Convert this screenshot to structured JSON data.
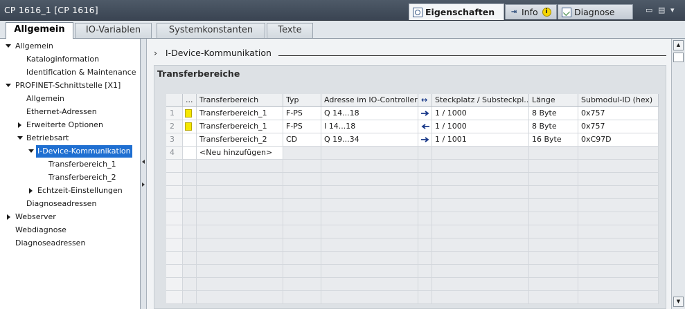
{
  "window": {
    "title": "CP 1616_1 [CP 1616]"
  },
  "inspector_tabs": [
    {
      "label": "Eigenschaften",
      "icon": "properties-icon",
      "active": true
    },
    {
      "label": "Info",
      "icon": "info-icon",
      "badge": "i",
      "active": false
    },
    {
      "label": "Diagnose",
      "icon": "diagnose-icon",
      "active": false
    }
  ],
  "window_controls": {
    "restore": "▭",
    "menu": "▤",
    "dropdown": "▾"
  },
  "subtabs": [
    {
      "label": "Allgemein",
      "active": true
    },
    {
      "label": "IO-Variablen",
      "active": false
    },
    {
      "label": "Systemkonstanten",
      "active": false
    },
    {
      "label": "Texte",
      "active": false
    }
  ],
  "nav": {
    "items": [
      {
        "label": "Allgemein",
        "level": 0,
        "expander": "down"
      },
      {
        "label": "Kataloginformation",
        "level": 1,
        "expander": "none"
      },
      {
        "label": "Identification & Maintenance",
        "level": 1,
        "expander": "none"
      },
      {
        "label": "PROFINET-Schnittstelle [X1]",
        "level": 0,
        "expander": "down"
      },
      {
        "label": "Allgemein",
        "level": 1,
        "expander": "none"
      },
      {
        "label": "Ethernet-Adressen",
        "level": 1,
        "expander": "none"
      },
      {
        "label": "Erweiterte Optionen",
        "level": 1,
        "expander": "right"
      },
      {
        "label": "Betriebsart",
        "level": 1,
        "expander": "down"
      },
      {
        "label": "I-Device-Kommunikation",
        "level": 2,
        "expander": "down",
        "selected": true
      },
      {
        "label": "Transferbereich_1",
        "level": 3,
        "expander": "none"
      },
      {
        "label": "Transferbereich_2",
        "level": 3,
        "expander": "none"
      },
      {
        "label": "Echtzeit-Einstellungen",
        "level": 2,
        "expander": "right"
      },
      {
        "label": "Diagnoseadressen",
        "level": 1,
        "expander": "none"
      },
      {
        "label": "Webserver",
        "level": 0,
        "expander": "right"
      },
      {
        "label": "Webdiagnose",
        "level": 0,
        "expander": "none"
      },
      {
        "label": "Diagnoseadressen",
        "level": 0,
        "expander": "none"
      }
    ]
  },
  "content": {
    "section_header": "I-Device-Kommunikation",
    "section_chevron": "›",
    "panel_title": "Transferbereiche"
  },
  "table": {
    "columns": [
      "",
      "...",
      "Transferbereich",
      "Typ",
      "Adresse im IO-Controller",
      "↔",
      "Steckplatz / Substeckpl...",
      "Länge",
      "Submodul-ID (hex)"
    ],
    "rows": [
      {
        "num": "1",
        "marker": "yellow",
        "name": "Transferbereich_1",
        "type": "F-PS",
        "address": "Q 14...18",
        "direction": "right",
        "slot": "1 / 1000",
        "length": "8 Byte",
        "submodule": "0x757"
      },
      {
        "num": "2",
        "marker": "yellow",
        "name": "Transferbereich_1",
        "type": "F-PS",
        "address": "I 14...18",
        "direction": "left",
        "slot": "1 / 1000",
        "length": "8 Byte",
        "submodule": "0x757"
      },
      {
        "num": "3",
        "marker": "none",
        "name": "Transferbereich_2",
        "type": "CD",
        "address": "Q 19...34",
        "direction": "right",
        "slot": "1 / 1001",
        "length": "16 Byte",
        "submodule": "0xC97D"
      },
      {
        "num": "4",
        "marker": "none",
        "name": "<Neu hinzufügen>",
        "type": "",
        "address": "",
        "direction": "none",
        "slot": "",
        "length": "",
        "submodule": ""
      }
    ]
  },
  "scrollbar": {
    "up": "▲",
    "down": "▼"
  },
  "colors": {
    "selection": "#1f6fd1",
    "titlebar": "#3a4452",
    "marker_yellow": "#f6e800",
    "arrow": "#1a3a8a"
  }
}
